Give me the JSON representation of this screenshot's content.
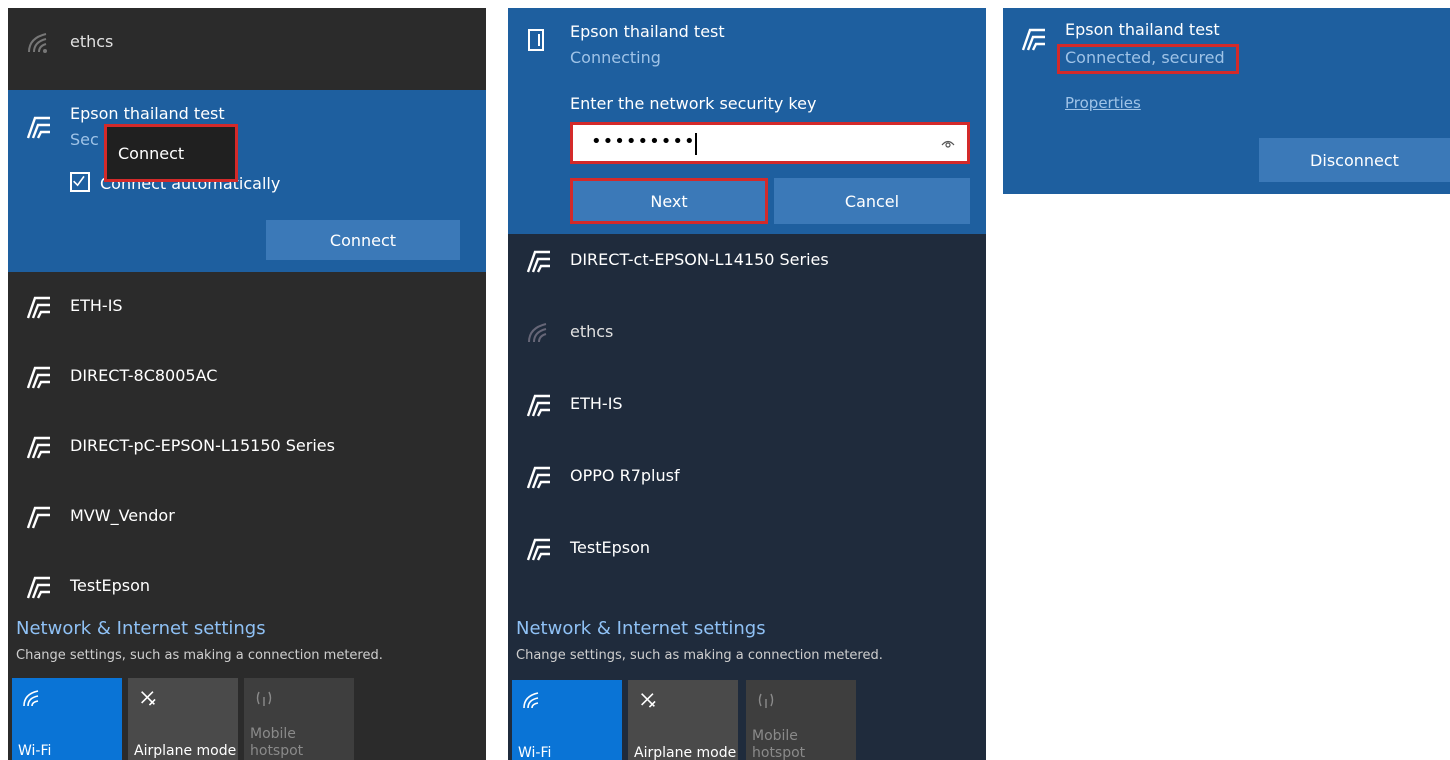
{
  "panel1": {
    "top_network": "ethcs",
    "selected": {
      "name": "Epson thailand test",
      "status_partial": "Sec",
      "context_menu": "Connect",
      "checkbox_label": "Connect automatically",
      "connect_button": "Connect"
    },
    "networks": [
      "ETH-IS",
      "DIRECT-8C8005AC",
      "DIRECT-pC-EPSON-L15150 Series",
      "MVW_Vendor",
      "TestEpson"
    ],
    "settings_link": "Network & Internet settings",
    "settings_desc": "Change settings, such as making a connection metered.",
    "tiles": {
      "wifi": "Wi-Fi",
      "airplane": "Airplane mode",
      "hotspot": "Mobile\nhotspot"
    }
  },
  "panel2": {
    "selected": {
      "name": "Epson thailand test",
      "status": "Connecting",
      "key_prompt": "Enter the network security key",
      "password_mask": "•••••••••",
      "next_button": "Next",
      "cancel_button": "Cancel"
    },
    "networks": [
      "DIRECT-ct-EPSON-L14150 Series",
      "ethcs",
      "ETH-IS",
      "OPPO R7plusf",
      "TestEpson"
    ],
    "settings_link": "Network & Internet settings",
    "settings_desc": "Change settings, such as making a connection metered.",
    "tiles": {
      "wifi": "Wi-Fi",
      "airplane": "Airplane mode",
      "hotspot": "Mobile\nhotspot"
    }
  },
  "panel3": {
    "name": "Epson thailand test",
    "status": "Connected, secured",
    "properties_link": "Properties",
    "disconnect_button": "Disconnect"
  },
  "colors": {
    "dark_bg": "#2b2b2b",
    "navy_bg": "#1f2b3c",
    "selected_blue": "#1e5f9f",
    "button_blue": "#3b79b8",
    "wifi_tile": "#0a74d6",
    "highlight_red": "#d32a2a"
  },
  "icons": {
    "secured": "wifi-lock-icon",
    "open": "wifi-faded-icon",
    "airplane": "airplane-icon",
    "hotspot": "hotspot-icon",
    "reveal": "eye-icon"
  }
}
